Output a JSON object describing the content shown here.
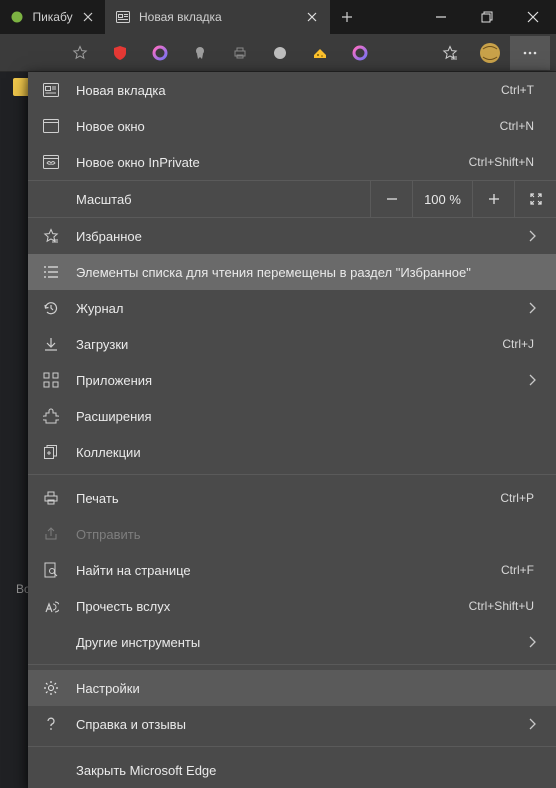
{
  "titlebar": {
    "tabs": [
      {
        "label": "Пикабу",
        "active": false
      },
      {
        "label": "Новая вкладка",
        "active": true
      }
    ]
  },
  "left": {
    "partial_text": "Вс"
  },
  "menu": {
    "new_tab": {
      "label": "Новая вкладка",
      "accel": "Ctrl+T"
    },
    "new_window": {
      "label": "Новое окно",
      "accel": "Ctrl+N"
    },
    "new_inprivate": {
      "label": "Новое окно InPrivate",
      "accel": "Ctrl+Shift+N"
    },
    "zoom": {
      "label": "Масштаб",
      "value": "100 %"
    },
    "favorites": {
      "label": "Избранное"
    },
    "reading_moved": {
      "label": "Элементы списка для чтения перемещены в раздел \"Избранное\""
    },
    "history": {
      "label": "Журнал"
    },
    "downloads": {
      "label": "Загрузки",
      "accel": "Ctrl+J"
    },
    "apps": {
      "label": "Приложения"
    },
    "extensions": {
      "label": "Расширения"
    },
    "collections": {
      "label": "Коллекции"
    },
    "print": {
      "label": "Печать",
      "accel": "Ctrl+P"
    },
    "share": {
      "label": "Отправить"
    },
    "find": {
      "label": "Найти на странице",
      "accel": "Ctrl+F"
    },
    "read_aloud": {
      "label": "Прочесть вслух",
      "accel": "Ctrl+Shift+U"
    },
    "more_tools": {
      "label": "Другие инструменты"
    },
    "settings": {
      "label": "Настройки"
    },
    "help": {
      "label": "Справка и отзывы"
    },
    "close_edge": {
      "label": "Закрыть Microsoft Edge"
    }
  }
}
